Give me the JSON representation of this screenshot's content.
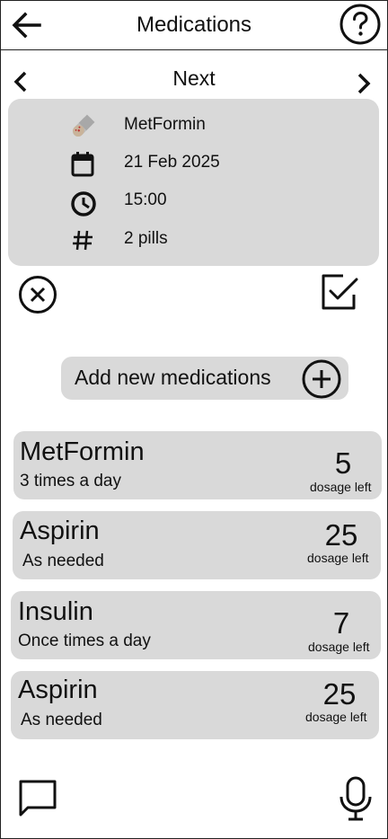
{
  "header": {
    "title": "Medications",
    "back_icon": "arrow-left-icon",
    "help_icon": "question-circle-icon"
  },
  "nav": {
    "label": "Next"
  },
  "next_dose": {
    "name": "MetFormin",
    "date": "21 Feb 2025",
    "time": "15:00",
    "quantity": "2 pills"
  },
  "actions": {
    "add_label": "Add new medications"
  },
  "medications": [
    {
      "name": "MetFormin",
      "frequency": "3 times a day",
      "count": "5",
      "left_label": "dosage left"
    },
    {
      "name": "Aspirin",
      "frequency": "As needed",
      "count": "25",
      "left_label": "dosage left"
    },
    {
      "name": "Insulin",
      "frequency": "Once times a day",
      "count": "7",
      "left_label": "dosage left"
    },
    {
      "name": "Aspirin",
      "frequency": "As needed",
      "count": "25",
      "left_label": "dosage left"
    }
  ],
  "colors": {
    "card": "#d9d9d9",
    "pill_gray": "#a8a8a8",
    "pill_tan": "#c9b39a"
  }
}
